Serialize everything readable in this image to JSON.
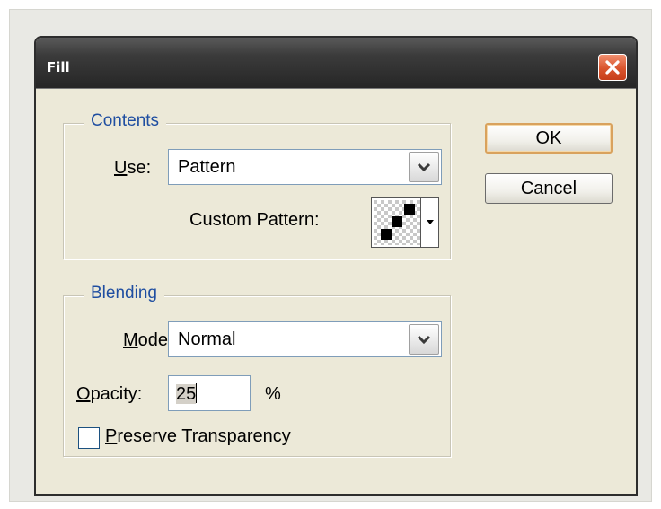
{
  "window": {
    "title": "Fill"
  },
  "contents": {
    "legend": "Contents",
    "use_label": "Use:",
    "use_value": "Pattern",
    "custom_pattern_label": "Custom Pattern:"
  },
  "blending": {
    "legend": "Blending",
    "mode_label": "Mode:",
    "mode_value": "Normal",
    "opacity_label": "Opacity:",
    "opacity_value": "25",
    "opacity_unit": "%",
    "preserve_label": "Preserve Transparency",
    "preserve_checked": false
  },
  "buttons": {
    "ok": "OK",
    "cancel": "Cancel"
  },
  "colors": {
    "legend_text": "#1f4ea1",
    "dialog_bg": "#ece9d8",
    "title_bar": "#262626",
    "close_button": "#d9542d",
    "default_button_border": "#d9a25d"
  },
  "icons": {
    "close": "close-x-icon",
    "dropdown": "chevron-down-icon",
    "pattern": "checker-pattern-icon"
  }
}
